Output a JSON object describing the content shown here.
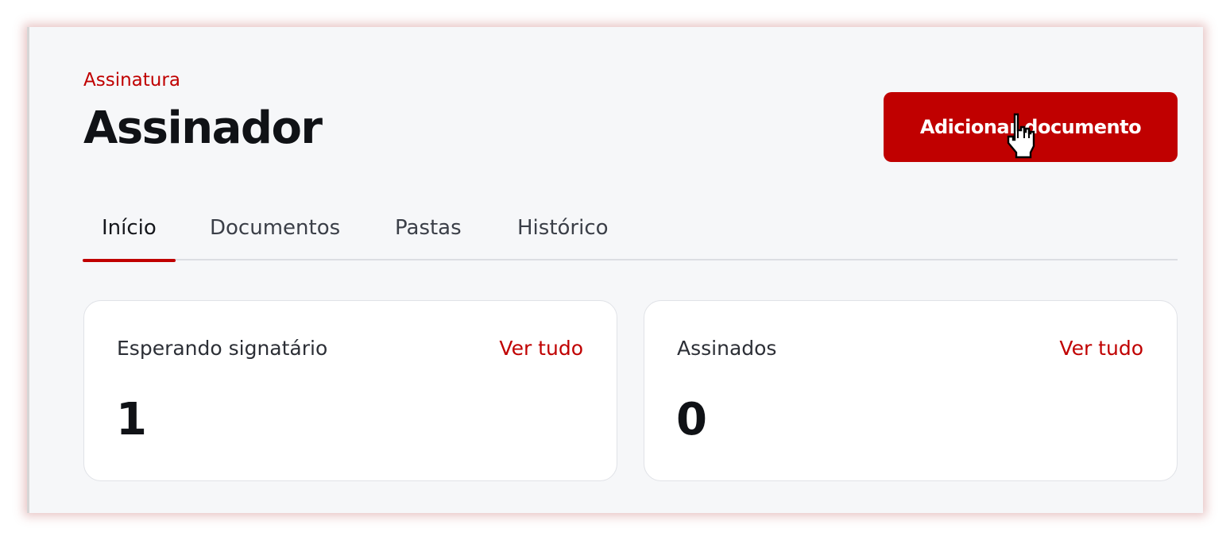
{
  "header": {
    "breadcrumb": "Assinatura",
    "title": "Assinador",
    "add_button_label": "Adicionar documento"
  },
  "tabs": [
    {
      "label": "Início",
      "active": true
    },
    {
      "label": "Documentos",
      "active": false
    },
    {
      "label": "Pastas",
      "active": false
    },
    {
      "label": "Histórico",
      "active": false
    }
  ],
  "cards": [
    {
      "label": "Esperando signatário",
      "link": "Ver tudo",
      "value": "1"
    },
    {
      "label": "Assinados",
      "link": "Ver tudo",
      "value": "0"
    }
  ],
  "colors": {
    "accent": "#c00000",
    "background": "#f6f7f9",
    "card": "#ffffff"
  },
  "icons": {
    "cursor": "hand-pointer-icon"
  }
}
